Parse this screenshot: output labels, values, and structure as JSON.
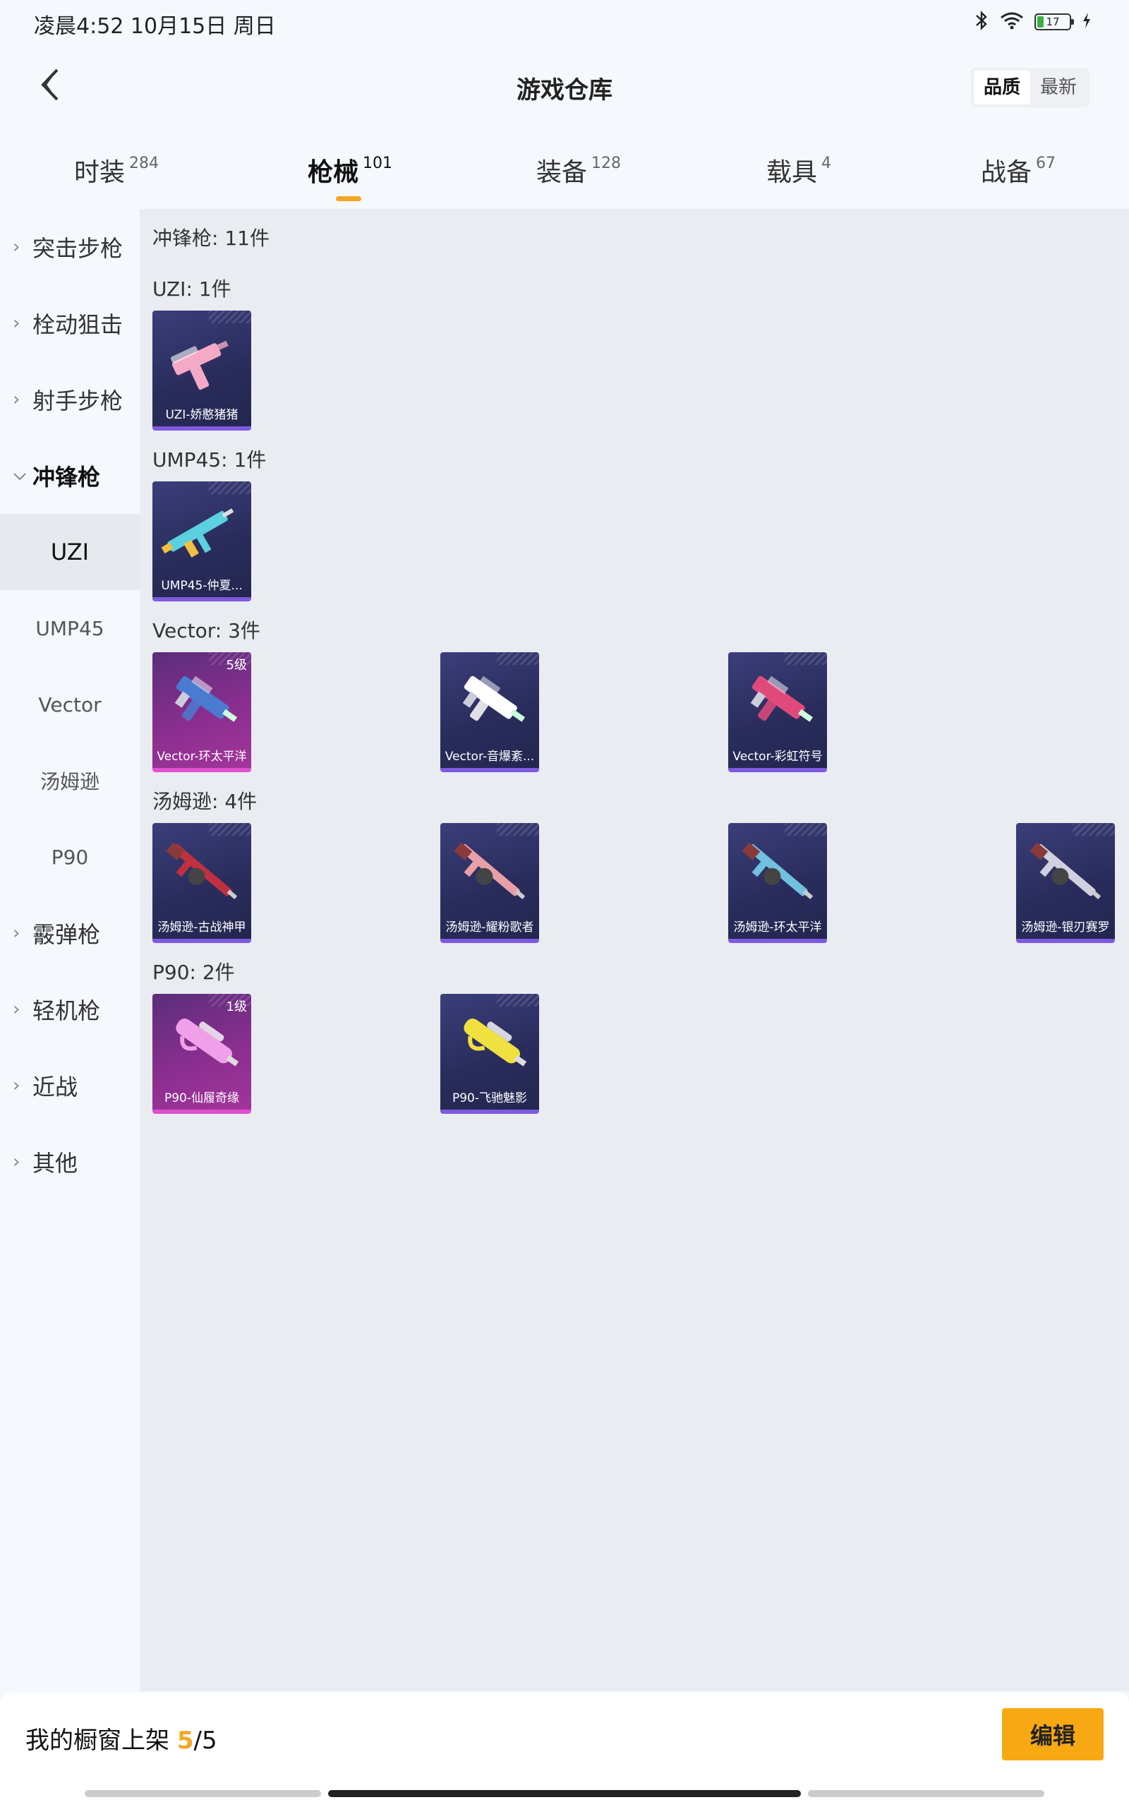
{
  "status_bar": {
    "time": "凌晨4:52 10月15日 周日",
    "battery": "17"
  },
  "header": {
    "title": "游戏仓库",
    "sort_options": [
      {
        "label": "品质",
        "active": true
      },
      {
        "label": "最新",
        "active": false
      }
    ]
  },
  "tabs": [
    {
      "label": "时装",
      "count": "284",
      "active": false
    },
    {
      "label": "枪械",
      "count": "101",
      "active": true
    },
    {
      "label": "装备",
      "count": "128",
      "active": false
    },
    {
      "label": "载具",
      "count": "4",
      "active": false
    },
    {
      "label": "战备",
      "count": "67",
      "active": false
    }
  ],
  "sidebar": {
    "items": [
      {
        "label": "突击步枪",
        "expanded": false
      },
      {
        "label": "栓动狙击",
        "expanded": false
      },
      {
        "label": "射手步枪",
        "expanded": false
      },
      {
        "label": "冲锋枪",
        "expanded": true
      },
      {
        "label": "霰弹枪",
        "expanded": false
      },
      {
        "label": "轻机枪",
        "expanded": false
      },
      {
        "label": "近战",
        "expanded": false
      },
      {
        "label": "其他",
        "expanded": false
      }
    ],
    "subitems": [
      {
        "label": "UZI",
        "active": true
      },
      {
        "label": "UMP45",
        "active": false
      },
      {
        "label": "Vector",
        "active": false
      },
      {
        "label": "汤姆逊",
        "active": false
      },
      {
        "label": "P90",
        "active": false
      }
    ]
  },
  "content": {
    "category_total": "冲锋枪: 11件",
    "groups": [
      {
        "heading": "UZI: 1件",
        "items": [
          {
            "name": "UZI-娇憨猪猪",
            "tier": "purple",
            "badge": "",
            "accent": "#f4a9c6",
            "gun": "uzi"
          }
        ]
      },
      {
        "heading": "UMP45: 1件",
        "items": [
          {
            "name": "UMP45-仲夏...",
            "tier": "purple",
            "badge": "",
            "accent": "#5ad0e0",
            "gun": "ump"
          }
        ]
      },
      {
        "heading": "Vector: 3件",
        "items": [
          {
            "name": "Vector-环太平洋",
            "tier": "pink",
            "badge": "5级",
            "accent": "#4a7bd0",
            "gun": "vector"
          },
          {
            "name": "Vector-音爆紊...",
            "tier": "purple",
            "badge": "",
            "accent": "#ffffff",
            "gun": "vector"
          },
          {
            "name": "Vector-彩虹符号",
            "tier": "purple",
            "badge": "",
            "accent": "#e04a7a",
            "gun": "vector"
          }
        ]
      },
      {
        "heading": "汤姆逊: 4件",
        "items": [
          {
            "name": "汤姆逊-古战神甲",
            "tier": "purple",
            "badge": "",
            "accent": "#c03040",
            "gun": "tommy"
          },
          {
            "name": "汤姆逊-耀粉歌者",
            "tier": "purple",
            "badge": "",
            "accent": "#e8a0a8",
            "gun": "tommy"
          },
          {
            "name": "汤姆逊-环太平洋",
            "tier": "purple",
            "badge": "",
            "accent": "#70c0e0",
            "gun": "tommy"
          },
          {
            "name": "汤姆逊-银刃赛罗",
            "tier": "purple",
            "badge": "",
            "accent": "#d0d0e0",
            "gun": "tommy"
          }
        ]
      },
      {
        "heading": "P90: 2件",
        "items": [
          {
            "name": "P90-仙履奇缘",
            "tier": "pink",
            "badge": "1级",
            "accent": "#f0a0e8",
            "gun": "p90"
          },
          {
            "name": "P90-飞驰魅影",
            "tier": "purple",
            "badge": "",
            "accent": "#f0e040",
            "gun": "p90"
          }
        ]
      }
    ]
  },
  "bottom_bar": {
    "label": "我的橱窗上架",
    "current": "5",
    "separator": "/",
    "total": "5",
    "edit_label": "编辑"
  },
  "colors": {
    "accent": "#f5a623",
    "edit_button": "#f7a813",
    "purple_tier": "#7d5ae0",
    "pink_tier": "#e04fd0"
  }
}
